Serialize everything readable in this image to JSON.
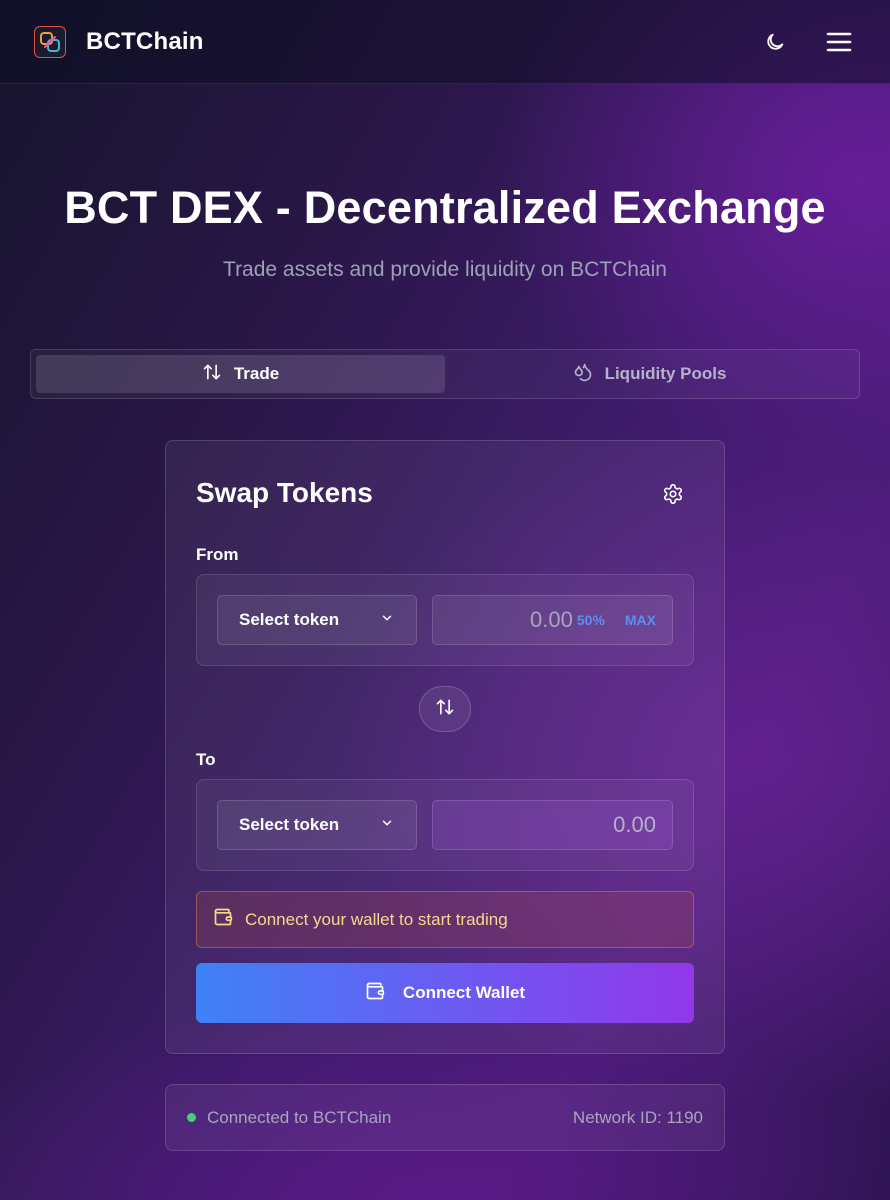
{
  "header": {
    "brand_name": "BCTChain",
    "logo_icon": "chain-link-logo",
    "theme_icon": "moon-icon",
    "menu_icon": "hamburger-menu-icon"
  },
  "hero": {
    "title": "BCT DEX - Decentralized Exchange",
    "subtitle": "Trade assets and provide liquidity on BCTChain"
  },
  "tabs": [
    {
      "label": "Trade",
      "icon": "swap-arrows-icon",
      "active": true
    },
    {
      "label": "Liquidity Pools",
      "icon": "droplets-icon",
      "active": false
    }
  ],
  "swap": {
    "title": "Swap Tokens",
    "settings_icon": "gear-icon",
    "from": {
      "label": "From",
      "token_placeholder": "Select token",
      "amount_placeholder": "0.00",
      "pct_label": "50%",
      "max_label": "MAX"
    },
    "to": {
      "label": "To",
      "token_placeholder": "Select token",
      "amount_placeholder": "0.00"
    },
    "notice": "Connect your wallet to start trading",
    "connect_label": "Connect Wallet"
  },
  "status": {
    "connection": "Connected to BCTChain",
    "network": "Network ID: 1190",
    "dot_color": "#3fd07a"
  },
  "colors": {
    "accent_blue": "#5b8ff0",
    "button_gradient_start": "#3e82f6",
    "button_gradient_end": "#9238ea",
    "notice_text": "#f6d98c"
  }
}
